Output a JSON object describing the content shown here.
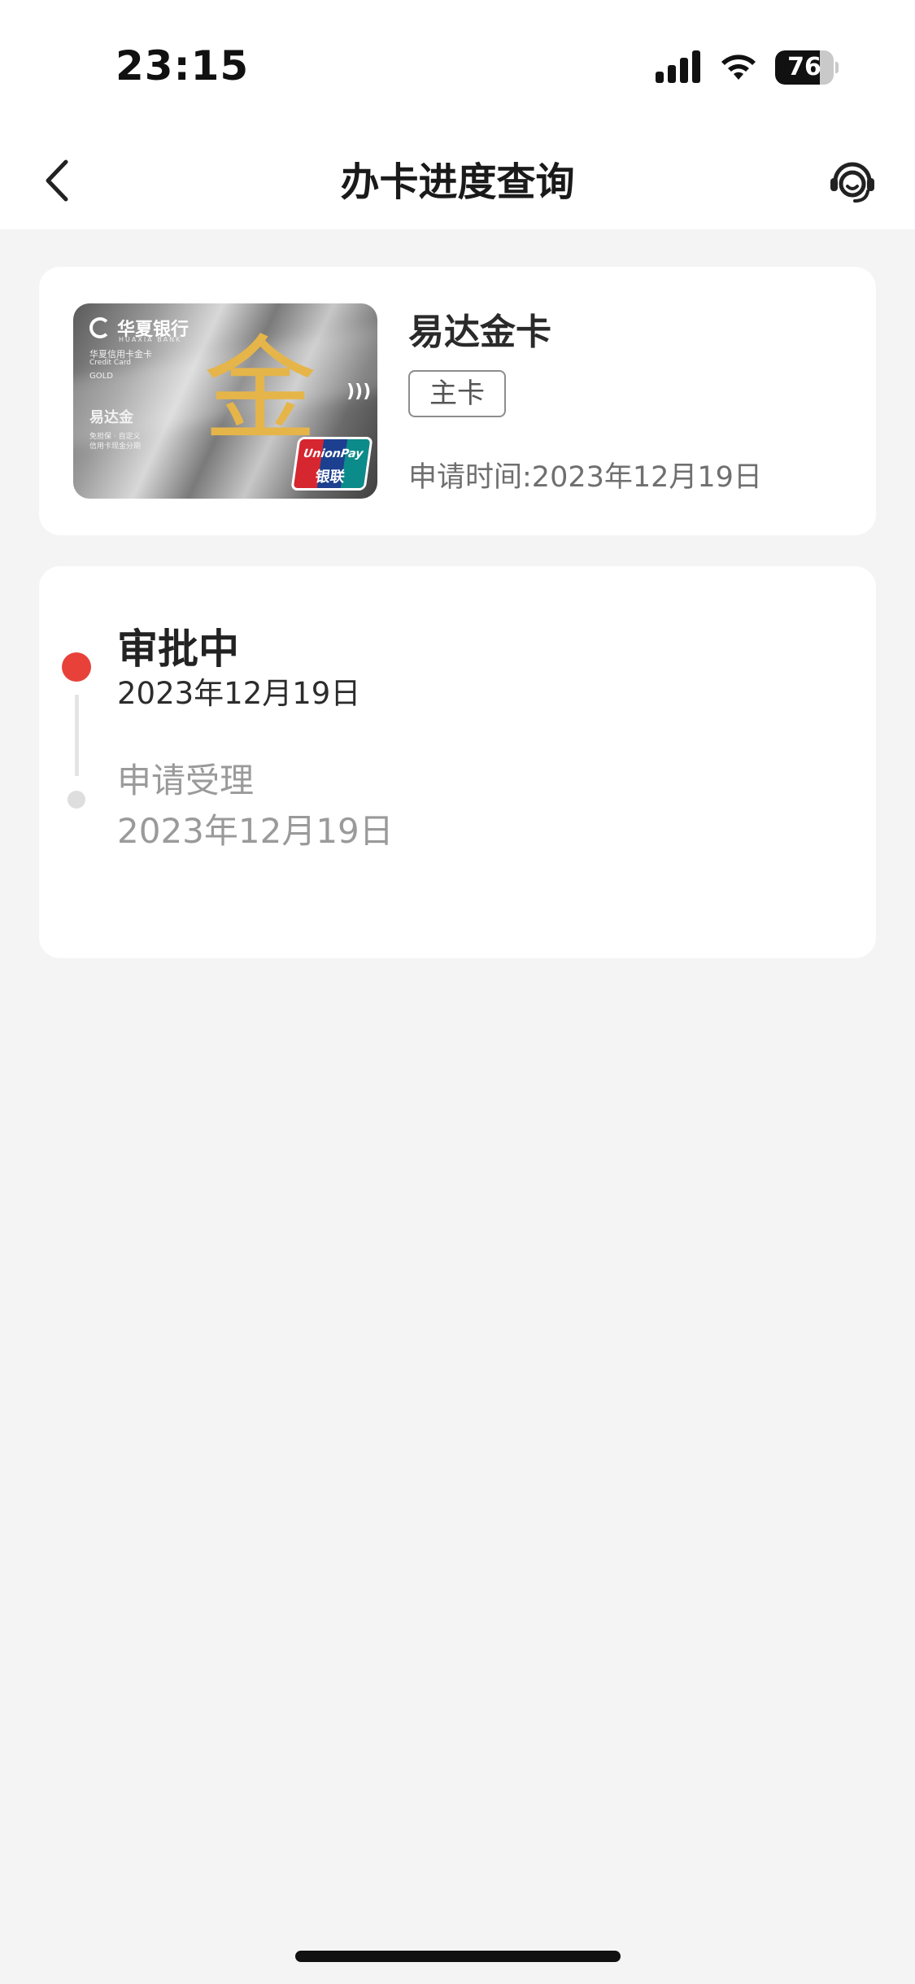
{
  "status_bar": {
    "time": "23:15",
    "battery_level": 76,
    "battery_text": "76",
    "icons": [
      "cellular-signal-icon",
      "wifi-icon",
      "battery-icon"
    ]
  },
  "nav": {
    "title": "办卡进度查询",
    "back_icon": "chevron-left-icon",
    "service_icon": "customer-service-headset-icon"
  },
  "card": {
    "image": {
      "bank_name": "华夏银行",
      "bank_name_en": "HUAXIA BANK",
      "product_line_cn": "华夏信用卡金卡",
      "product_line_en": "Credit Card",
      "tier": "GOLD",
      "card_brand_text": "易达金",
      "slogan_1": "免担保 · 自定义",
      "slogan_2": "信用卡现金分期",
      "gold_character": "金",
      "nfc_symbol": ")))",
      "network_en": "UnionPay",
      "network_cn": "银联"
    },
    "name": "易达金卡",
    "type_badge": "主卡",
    "apply_time_label": "申请时间:",
    "apply_time_value": "2023年12月19日"
  },
  "progress": {
    "accent_color": "#e8413a",
    "steps": [
      {
        "title": "审批中",
        "date": "2023年12月19日",
        "active": true
      },
      {
        "title": "申请受理",
        "date": "2023年12月19日",
        "active": false
      }
    ]
  }
}
